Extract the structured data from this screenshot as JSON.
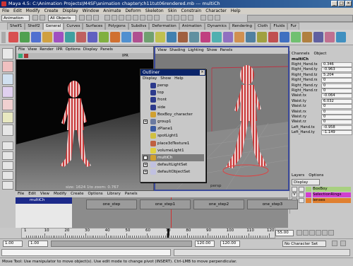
{
  "window": {
    "title": "Maya 4.5: C:\\Animation Projects\\M4SF\\animation chapter\\ch11tut06rendered.mb  ---  multiCh"
  },
  "menubar": [
    "File",
    "Edit",
    "Modify",
    "Create",
    "Display",
    "Window",
    "Animate",
    "Deform",
    "Skeleton",
    "Skin",
    "Constrain",
    "Character",
    "Help"
  ],
  "statusline": {
    "mode": "Animation",
    "selection": "All Objects"
  },
  "shelf_tabs": [
    "Shelf1",
    "Shelf2",
    "General",
    "Curves",
    "Surfaces",
    "Polygons",
    "Subdivs",
    "Deformation",
    "Animation",
    "Dynamics",
    "Rendering",
    "Cloth",
    "Fluids",
    "Fur"
  ],
  "active_shelf": "General",
  "left_view": {
    "menus": [
      "File",
      "View",
      "Render",
      "IPR",
      "Options",
      "Display",
      "Panels"
    ],
    "info": "size: 1624  1to zoom: 0.767",
    "ipr": "IPR"
  },
  "right_view": {
    "menus": [
      "View",
      "Shading",
      "Lighting",
      "Show",
      "Panels"
    ],
    "label": "persp"
  },
  "outliner": {
    "title": "Outliner",
    "menus": [
      "Display",
      "Show",
      "Help"
    ],
    "items": [
      {
        "label": "persp",
        "icon": "camera-icon"
      },
      {
        "label": "top",
        "icon": "camera-icon"
      },
      {
        "label": "front",
        "icon": "camera-icon"
      },
      {
        "label": "side",
        "icon": "camera-icon"
      },
      {
        "label": "BoxBoy_character",
        "icon": "character-icon"
      },
      {
        "label": "group1",
        "icon": "group-icon"
      },
      {
        "label": "zPlane1",
        "icon": "plane-icon"
      },
      {
        "label": "spotLight1",
        "icon": "spotlight-icon"
      },
      {
        "label": "place3dTexture1",
        "icon": "texture-icon"
      },
      {
        "label": "volumeLight1",
        "icon": "light-icon"
      },
      {
        "label": "multiCh",
        "icon": "character-set-icon"
      },
      {
        "label": "defaultLightSet",
        "icon": "set-icon"
      },
      {
        "label": "defaultObjectSet",
        "icon": "set-icon"
      }
    ]
  },
  "channels": {
    "header": [
      "Channels",
      "Object"
    ],
    "object": "multiCh",
    "rows": [
      {
        "name": "Right_Hand.tx",
        "value": "0.346"
      },
      {
        "name": "Right_Hand.ty",
        "value": "-0.963"
      },
      {
        "name": "Right_Hand.tz",
        "value": "5.204"
      },
      {
        "name": "Right_Hand.rx",
        "value": "0"
      },
      {
        "name": "Right_Hand.ry",
        "value": "0"
      },
      {
        "name": "Right_Hand.rz",
        "value": "0"
      },
      {
        "name": "Waist.tx",
        "value": "-0.064"
      },
      {
        "name": "Waist.ty",
        "value": "6.032"
      },
      {
        "name": "Waist.tz",
        "value": "0"
      },
      {
        "name": "Waist.rx",
        "value": "0"
      },
      {
        "name": "Waist.ry",
        "value": "0"
      },
      {
        "name": "Waist.rz",
        "value": "0"
      },
      {
        "name": "Left_Hand.tx",
        "value": "-0.958"
      },
      {
        "name": "Left_Hand.ty",
        "value": "-1.149"
      }
    ]
  },
  "layers": {
    "header": [
      "Layers",
      "Options"
    ],
    "mode": "Display",
    "rows": [
      {
        "flag": "",
        "name": "BoxBoy",
        "color": "#a8d080"
      },
      {
        "flag": "V",
        "name": "SelectionRings",
        "color": "#d040d0"
      },
      {
        "flag": "",
        "name": "lenses",
        "color": "#e08030"
      }
    ]
  },
  "trax": {
    "menus": [
      "File",
      "Edit",
      "View",
      "Modify",
      "Create",
      "Options",
      "Library",
      "Panels"
    ],
    "track": "multiCh",
    "clips": [
      "one_step",
      "one_step1",
      "one_step2",
      "one_step3"
    ]
  },
  "time": {
    "ticks": [
      "1",
      "10",
      "20",
      "30",
      "40",
      "50",
      "60",
      "70",
      "80",
      "90",
      "100",
      "110",
      "120"
    ],
    "current": "55.00",
    "start": "1.00",
    "range_start": "1.00",
    "range_end": "120.00",
    "end": "120.00",
    "char_set": "No Character Set"
  },
  "help_line": "Move Tool: Use manipulator to move object(s). Use edit mode to change pivot (INSERT). Ctrl-LMB to move perpendicular.",
  "colors": {
    "title": "#0a246a",
    "selected": "#7d7d7d",
    "playhead": "#d03030"
  }
}
